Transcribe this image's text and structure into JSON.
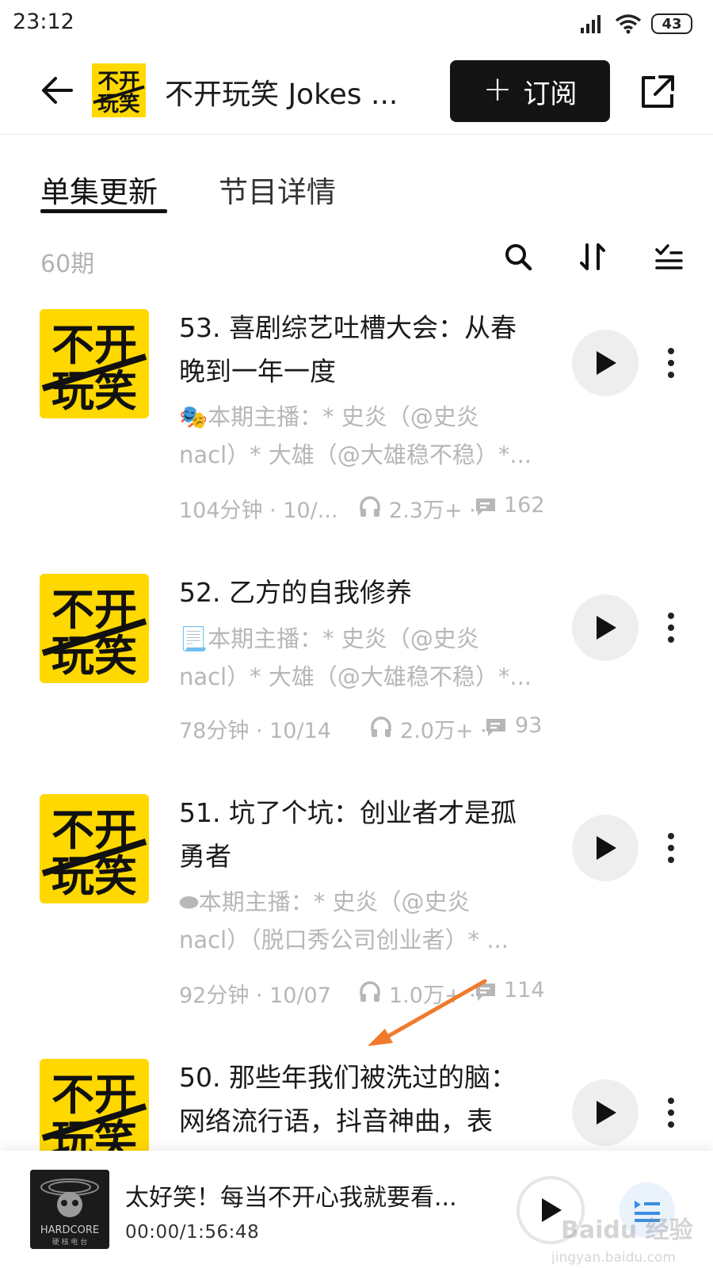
{
  "status_bar": {
    "time": "23:12",
    "battery": "43",
    "icons": [
      "signal-icon",
      "wifi-icon",
      "battery-icon"
    ]
  },
  "header": {
    "back_icon": "arrow-left-icon",
    "title": "不开玩笑 Jokes ...",
    "logo_glyphs": [
      "不开",
      "玩笑"
    ],
    "subscribe_plus": "+",
    "subscribe_label": "订阅",
    "share_icon": "share-external-icon"
  },
  "tabs": [
    {
      "label": "单集更新",
      "active": true
    },
    {
      "label": "节目详情",
      "active": false
    }
  ],
  "list_toolbar": {
    "count": "60期",
    "icons": [
      "search-icon",
      "sort-icon",
      "multi-select-icon"
    ]
  },
  "episodes": [
    {
      "title_lines": [
        "53. 喜剧综艺吐槽大会：从春",
        "晚到一年一度"
      ],
      "desc_lines": [
        "🎭本期主播：* 史炎（@史炎",
        "nacl）* 大雄（@大雄稳不稳）*..."
      ],
      "duration_date": "104分钟 · 10/...",
      "plays": "2.3万+ ·",
      "comments": "162"
    },
    {
      "title_lines": [
        "52. 乙方的自我修养"
      ],
      "desc_lines": [
        "📃本期主播：* 史炎（@史炎",
        "nacl）* 大雄（@大雄稳不稳）*..."
      ],
      "duration_date": "78分钟 · 10/14",
      "plays": "2.0万+ ·",
      "comments": "93"
    },
    {
      "title_lines": [
        "51. 坑了个坑：创业者才是孤",
        "勇者"
      ],
      "desc_lines": [
        "⬬本期主播：* 史炎（@史炎",
        "nacl）（脱口秀公司创业者）* ..."
      ],
      "duration_date": "92分钟 · 10/07",
      "plays": "1.0万+ ·",
      "comments": "114"
    },
    {
      "title_lines": [
        "50. 那些年我们被洗过的脑：",
        "网络流行语，抖音神曲，表"
      ],
      "desc_lines": [],
      "duration_date": "",
      "plays": "",
      "comments": ""
    }
  ],
  "mini_player": {
    "title": "太好笑！每当不开心我就要看...",
    "time": "00:00/1:56:48",
    "cover_text": "HARDCORE",
    "cover_subtext": "硬 核 电 台"
  },
  "watermark": {
    "text": "Baidu 经验",
    "url": "jingyan.baidu.com"
  },
  "colors": {
    "brand_yellow": "#ffd800",
    "subscribe_bg": "#141414",
    "muted_text": "#b7b7b7",
    "annotation_arrow": "#f07a2c"
  }
}
